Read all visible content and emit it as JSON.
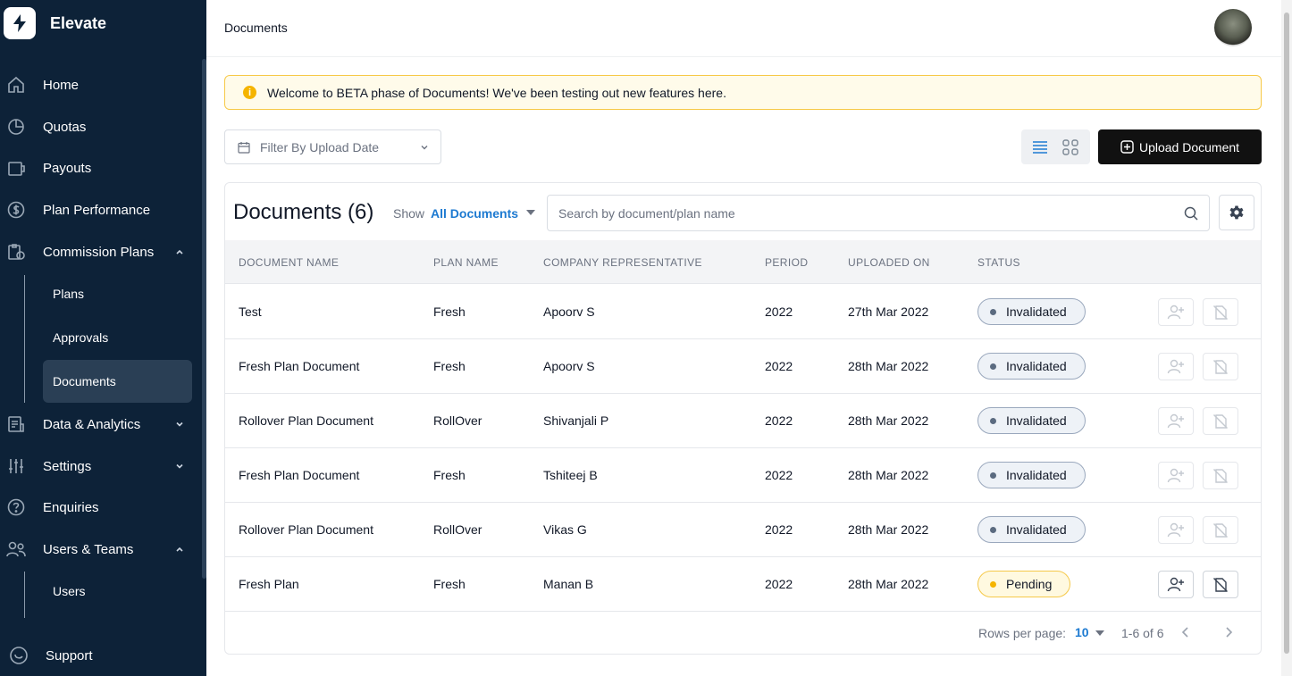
{
  "app": {
    "name": "Elevate"
  },
  "nav": {
    "home": "Home",
    "quotas": "Quotas",
    "payouts": "Payouts",
    "plan_performance": "Plan Performance",
    "commission_plans": "Commission Plans",
    "plans": "Plans",
    "approvals": "Approvals",
    "documents": "Documents",
    "data_analytics": "Data & Analytics",
    "settings": "Settings",
    "enquiries": "Enquiries",
    "users_teams": "Users & Teams",
    "users": "Users",
    "support": "Support"
  },
  "header": {
    "title": "Documents"
  },
  "banner": {
    "text": "Welcome to BETA phase of Documents! We've been testing out new features here."
  },
  "filter": {
    "placeholder": "Filter By Upload Date"
  },
  "upload_button": "Upload Document",
  "card": {
    "title": "Documents (6)",
    "show_label": "Show",
    "show_value": "All Documents",
    "search_placeholder": "Search by document/plan name"
  },
  "table": {
    "headers": [
      "DOCUMENT NAME",
      "PLAN NAME",
      "COMPANY REPRESENTATIVE",
      "PERIOD",
      "UPLOADED ON",
      "STATUS"
    ],
    "rows": [
      {
        "doc": "Test",
        "plan": "Fresh",
        "rep": "Apoorv S",
        "period": "2022",
        "uploaded": "27th Mar 2022",
        "status": "Invalidated"
      },
      {
        "doc": "Fresh Plan Document",
        "plan": "Fresh",
        "rep": "Apoorv S",
        "period": "2022",
        "uploaded": "28th Mar 2022",
        "status": "Invalidated"
      },
      {
        "doc": "Rollover Plan Document",
        "plan": "RollOver",
        "rep": "Shivanjali P",
        "period": "2022",
        "uploaded": "28th Mar 2022",
        "status": "Invalidated"
      },
      {
        "doc": "Fresh Plan Document",
        "plan": "Fresh",
        "rep": "Tshiteej B",
        "period": "2022",
        "uploaded": "28th Mar 2022",
        "status": "Invalidated"
      },
      {
        "doc": "Rollover Plan Document",
        "plan": "RollOver",
        "rep": "Vikas G",
        "period": "2022",
        "uploaded": "28th Mar 2022",
        "status": "Invalidated"
      },
      {
        "doc": "Fresh Plan",
        "plan": "Fresh",
        "rep": "Manan B",
        "period": "2022",
        "uploaded": "28th Mar 2022",
        "status": "Pending"
      }
    ]
  },
  "pagination": {
    "rows_per_page_label": "Rows per page:",
    "rows_per_page": "10",
    "range": "1-6 of 6"
  },
  "colors": {
    "sidebar": "#0d2238",
    "accent": "#1d7ad1",
    "warning": "#f5b400",
    "upload_button": "#111111"
  }
}
